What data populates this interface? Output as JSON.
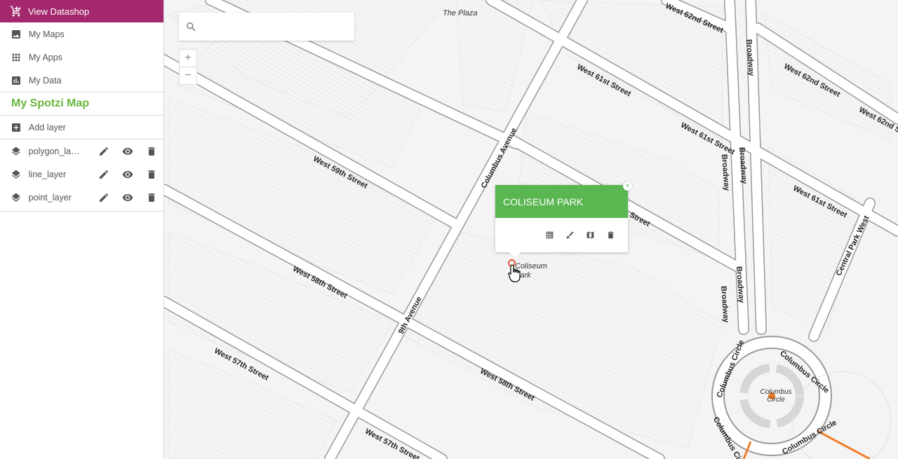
{
  "sidebar": {
    "header_label": "View Datashop",
    "nav": [
      {
        "label": "My Maps",
        "icon": "image-icon"
      },
      {
        "label": "My Apps",
        "icon": "grid-icon"
      },
      {
        "label": "My Data",
        "icon": "chart-icon"
      }
    ],
    "map_title": "My Spotzi Map",
    "add_layer_label": "Add layer",
    "layers": [
      {
        "name": "polygon_layer"
      },
      {
        "name": "line_layer"
      },
      {
        "name": "point_layer"
      }
    ]
  },
  "search": {
    "placeholder": "",
    "value": ""
  },
  "zoom": {
    "in_label": "+",
    "out_label": "−"
  },
  "popup": {
    "title": "COLISEUM PARK",
    "close_label": "×",
    "actions": [
      "table-icon",
      "brush-icon",
      "map-icon",
      "trash-icon"
    ]
  },
  "map_labels": {
    "plaza": "The Plaza",
    "w62": "West 62nd Street",
    "w61": "West 61st Street",
    "w59": "West 59th Street",
    "w58": "West 58th Street",
    "w57": "West 57th Street",
    "columbus_ave": "Columbus Avenue",
    "ninth_ave": "9th Avenue",
    "broadway": "Broadway",
    "cpw": "Central Park West",
    "columbus_circle": "Columbus Circle",
    "coliseum_park": "Coliseum Park",
    "street": "Street"
  },
  "colors": {
    "brand": "#a3286e",
    "accent": "#6ab53d",
    "popup_header": "#5ab650",
    "marker": "#e05a3c",
    "route": "#f07d2a"
  }
}
